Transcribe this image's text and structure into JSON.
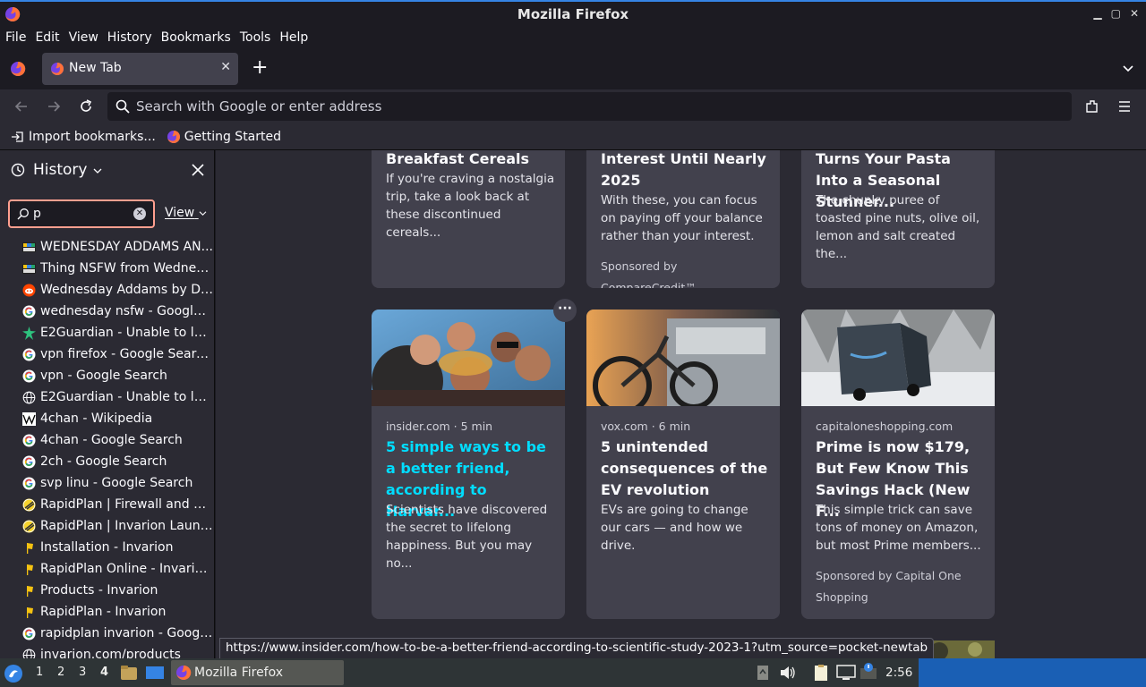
{
  "window": {
    "title": "Mozilla Firefox",
    "min": "▁",
    "max": "▢",
    "close": "✕"
  },
  "menu": [
    "File",
    "Edit",
    "View",
    "History",
    "Bookmarks",
    "Tools",
    "Help"
  ],
  "tab": {
    "title": "New Tab",
    "close": "✕",
    "new": "+"
  },
  "urlbar": {
    "placeholder": "Search with Google or enter address"
  },
  "bookmarks": [
    {
      "label": "Import bookmarks..."
    },
    {
      "label": "Getting Started"
    }
  ],
  "sidebar": {
    "title": "History",
    "search_value": "p",
    "view_label": "View",
    "items": [
      {
        "label": "WEDNESDAY ADDAMS AN...",
        "icon": "tv"
      },
      {
        "label": "Thing NSFW from Wednes...",
        "icon": "tv"
      },
      {
        "label": "Wednesday Addams by Db...",
        "icon": "reddit"
      },
      {
        "label": "wednesday nsfw - Google ...",
        "icon": "google"
      },
      {
        "label": "E2Guardian - Unable to loa...",
        "icon": "e2"
      },
      {
        "label": "vpn firefox - Google Searc...",
        "icon": "google"
      },
      {
        "label": "vpn - Google Search",
        "icon": "google"
      },
      {
        "label": "E2Guardian - Unable to loa...",
        "icon": "globe"
      },
      {
        "label": "4chan - Wikipedia",
        "icon": "wiki"
      },
      {
        "label": "4chan - Google Search",
        "icon": "google"
      },
      {
        "label": "2ch - Google Search",
        "icon": "google"
      },
      {
        "label": "svp linu - Google Search",
        "icon": "google"
      },
      {
        "label": "RapidPlan | Firewall and Pr...",
        "icon": "rapid"
      },
      {
        "label": "RapidPlan | Invarion Launc...",
        "icon": "rapid"
      },
      {
        "label": "Installation - Invarion",
        "icon": "flag"
      },
      {
        "label": "RapidPlan Online - Invario...",
        "icon": "flag"
      },
      {
        "label": "Products - Invarion",
        "icon": "flag"
      },
      {
        "label": "RapidPlan - Invarion",
        "icon": "flag"
      },
      {
        "label": "rapidplan invarion - Googl...",
        "icon": "google"
      },
      {
        "label": "invarion.com/products",
        "icon": "globe"
      }
    ]
  },
  "cards_top": [
    {
      "headline": "Breakfast Cereals",
      "desc": "If you're craving a nostalgia trip, take a look back at these discontinued cereals...",
      "sponsor": ""
    },
    {
      "headline": "Interest Until Nearly 2025",
      "desc": "With these, you can focus on paying off your balance rather than your interest.",
      "sponsor": "Sponsored by CompareCredit™"
    },
    {
      "headline": "Turns Your Pasta Into a Seasonal Stunner...",
      "desc": "The chunky puree of toasted pine nuts, olive oil, lemon and salt created the...",
      "sponsor": ""
    }
  ],
  "cards": [
    {
      "source": "insider.com · 5 min",
      "headline": "5 simple ways to be a better friend, according to Harvar...",
      "desc": "Scientists have discovered the secret to lifelong happiness. But you may no...",
      "sponsor": "",
      "image": "friends-photo",
      "headline_color": "#00ddff"
    },
    {
      "source": "vox.com · 6 min",
      "headline": "5 unintended consequences of the EV revolution",
      "desc": "EVs are going to change our cars — and how we drive.",
      "sponsor": "",
      "image": "ebike-photo",
      "headline_color": "#fbfbfe"
    },
    {
      "source": "capitaloneshopping.com",
      "headline": "Prime is now $179, But Few Know This Savings Hack (New F...",
      "desc": "This simple trick can save tons of money on Amazon, but most Prime members...",
      "sponsor": "Sponsored by Capital One Shopping",
      "image": "amazon-van-photo",
      "headline_color": "#fbfbfe"
    }
  ],
  "card_menu": "···",
  "status_url": "https://www.insider.com/how-to-be-a-better-friend-according-to-scientific-study-2023-1?utm_source=pocket-newtab",
  "taskbar": {
    "workspaces": [
      "1",
      "2",
      "3",
      "4"
    ],
    "app": "Mozilla Firefox",
    "clock": "2:56"
  },
  "colors": {
    "accent": "#3584e4",
    "link": "#00ddff",
    "focus": "#ff9f8f"
  }
}
